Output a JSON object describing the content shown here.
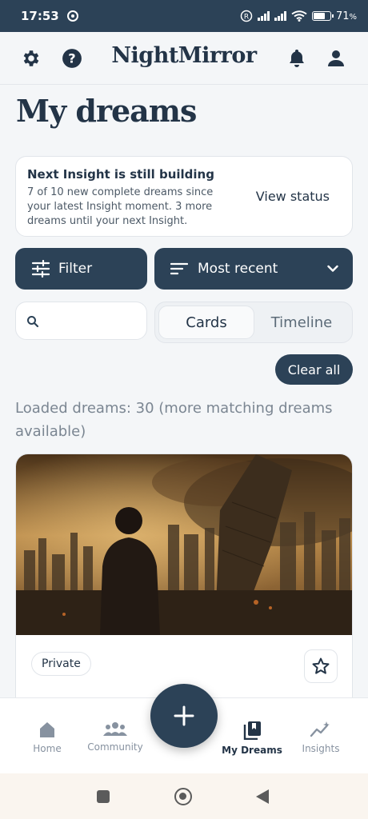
{
  "status_bar": {
    "time": "17:53",
    "battery": "71",
    "battery_unit": "%"
  },
  "header": {
    "app_title": "NightMirror"
  },
  "page": {
    "title": "My dreams"
  },
  "insight_card": {
    "heading": "Next Insight is still building",
    "description": "7 of 10 new complete dreams since your latest Insight moment. 3 more dreams until your next Insight.",
    "action": "View status"
  },
  "controls": {
    "filter_label": "Filter",
    "sort_label": "Most recent",
    "search_placeholder": "",
    "view_options": [
      "Cards",
      "Timeline"
    ],
    "active_view": "Cards",
    "clear_label": "Clear all"
  },
  "results": {
    "loaded_text": "Loaded dreams: 30 (more matching dreams available)"
  },
  "dream_card": {
    "visibility": "Private"
  },
  "bottom_nav": {
    "items": [
      {
        "label": "Home",
        "icon": "home-icon"
      },
      {
        "label": "Community",
        "icon": "community-icon"
      },
      {
        "label": "My Dreams",
        "icon": "book-icon"
      },
      {
        "label": "Insights",
        "icon": "sparkle-chart-icon"
      }
    ],
    "active": "My Dreams"
  },
  "colors": {
    "primary": "#2c4257",
    "background": "#f4f6f8",
    "text": "#233447",
    "muted": "#7b8692"
  }
}
